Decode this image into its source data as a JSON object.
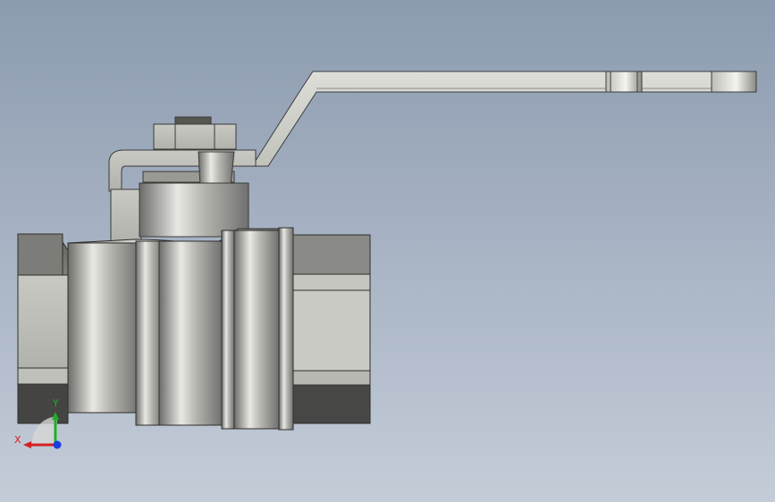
{
  "viewport": {
    "background_top": "#8c9bb0",
    "background_bottom": "#c4ccd8"
  },
  "triad": {
    "x_label": "X",
    "y_label": "Y",
    "x_color": "#d42020",
    "y_color": "#1fae2a",
    "z_color": "#1a3ee0"
  },
  "model": {
    "part": "ball valve",
    "material_color": "#a8a8a2"
  }
}
